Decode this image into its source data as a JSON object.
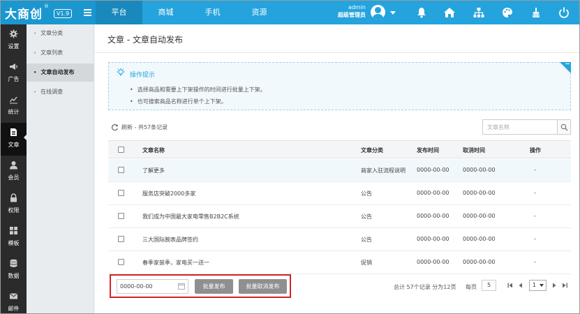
{
  "brand": {
    "logo_text": "大商创",
    "logo_reg": "®",
    "version": "V1.9"
  },
  "top_nav": {
    "tabs": [
      {
        "label": "平台",
        "active": true
      },
      {
        "label": "商城",
        "active": false
      },
      {
        "label": "手机",
        "active": false
      },
      {
        "label": "资源",
        "active": false
      }
    ]
  },
  "user": {
    "name": "admin",
    "role": "超级管理员"
  },
  "top_icons": [
    "bell-icon",
    "home-icon",
    "sitemap-icon",
    "palette-icon",
    "broom-icon",
    "power-icon"
  ],
  "sidebar": {
    "items": [
      {
        "label": "设置",
        "icon": "gear-icon"
      },
      {
        "label": "广告",
        "icon": "megaphone-icon"
      },
      {
        "label": "统计",
        "icon": "chart-icon"
      },
      {
        "label": "文章",
        "icon": "document-icon",
        "active": true
      },
      {
        "label": "会员",
        "icon": "user-icon"
      },
      {
        "label": "权限",
        "icon": "lock-icon"
      },
      {
        "label": "模板",
        "icon": "grid-icon"
      },
      {
        "label": "数据",
        "icon": "database-icon"
      },
      {
        "label": "邮件",
        "icon": "mail-icon"
      }
    ]
  },
  "submenu": {
    "items": [
      {
        "label": "文章分类"
      },
      {
        "label": "文章列表"
      },
      {
        "label": "文章自动发布",
        "active": true
      },
      {
        "label": "在线调查"
      }
    ]
  },
  "page": {
    "title": "文章 - 文章自动发布"
  },
  "tips": {
    "title": "操作提示",
    "lines": [
      "选择商品和需要上下架操作的时间进行批量上下架。",
      "也可搜索商品名称进行单个上下架。"
    ]
  },
  "toolbar": {
    "refresh_text": "刷新 - 共57条记录",
    "search_placeholder": "文章名称"
  },
  "table": {
    "headers": [
      "文章名称",
      "文章分类",
      "发布时间",
      "取消时间",
      "操作"
    ],
    "rows": [
      {
        "name": "了解更多",
        "category": "商家入驻流程说明",
        "publish": "0000-00-00",
        "cancel": "0000-00-00",
        "op": "-"
      },
      {
        "name": "服务店突破2000多家",
        "category": "公告",
        "publish": "0000-00-00",
        "cancel": "0000-00-00",
        "op": "-"
      },
      {
        "name": "我们成为中国最大家电零售B2B2C系统",
        "category": "公告",
        "publish": "0000-00-00",
        "cancel": "0000-00-00",
        "op": "-"
      },
      {
        "name": "三大国际腕表品牌签约",
        "category": "公告",
        "publish": "0000-00-00",
        "cancel": "0000-00-00",
        "op": "-"
      },
      {
        "name": "春季家装季，家电买一送一",
        "category": "促销",
        "publish": "0000-00-00",
        "cancel": "0000-00-00",
        "op": "-"
      }
    ]
  },
  "footer": {
    "date_value": "0000-00-00",
    "batch_publish": "批量发布",
    "batch_cancel": "批量取消发布",
    "total_text": "总计 57个记录 分为12页",
    "per_page_label": "每页",
    "per_page_value": "5",
    "current_page": "1"
  },
  "colors": {
    "primary": "#24a3dd",
    "primary_dark": "#1988bd",
    "sidebar_bg": "#2b2b2b",
    "highlight_border": "#d42222",
    "button_gray": "#8f8f8f"
  }
}
